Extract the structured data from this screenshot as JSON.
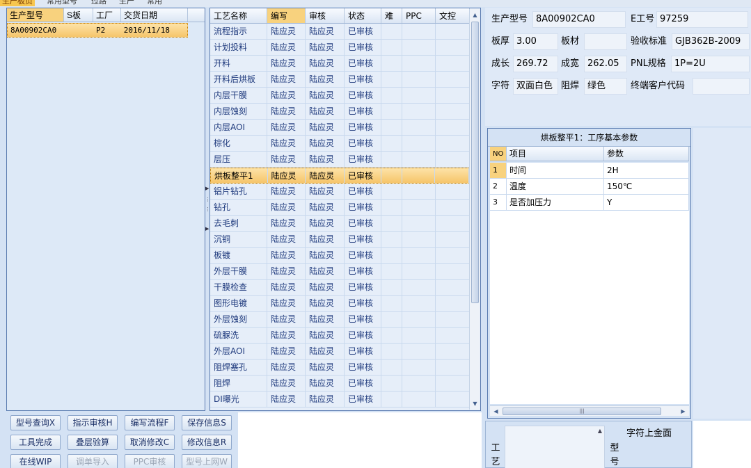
{
  "top_tabs": [
    {
      "label": "生产板页",
      "active": true
    },
    {
      "label": "常用型号"
    },
    {
      "label": "过路"
    },
    {
      "label": "生产"
    },
    {
      "label": "常用"
    }
  ],
  "product_list": {
    "headers": [
      "生产型号",
      "S板",
      "工厂",
      "交货日期"
    ],
    "rows": [
      {
        "model": "8A00902CA0",
        "s": "",
        "factory": "P2",
        "date": "2016/11/18"
      }
    ]
  },
  "process_grid": {
    "headers": [
      "工艺名称",
      "编写",
      "审核",
      "状态",
      "难",
      "PPC",
      "文控"
    ],
    "rows": [
      {
        "name": "流程指示",
        "writer": "陆应灵",
        "reviewer": "陆应灵",
        "status": "已审核"
      },
      {
        "name": "计划投料",
        "writer": "陆应灵",
        "reviewer": "陆应灵",
        "status": "已审核"
      },
      {
        "name": "开料",
        "writer": "陆应灵",
        "reviewer": "陆应灵",
        "status": "已审核"
      },
      {
        "name": "开料后烘板",
        "writer": "陆应灵",
        "reviewer": "陆应灵",
        "status": "已审核"
      },
      {
        "name": "内层干膜",
        "writer": "陆应灵",
        "reviewer": "陆应灵",
        "status": "已审核"
      },
      {
        "name": "内层蚀刻",
        "writer": "陆应灵",
        "reviewer": "陆应灵",
        "status": "已审核"
      },
      {
        "name": "内层AOI",
        "writer": "陆应灵",
        "reviewer": "陆应灵",
        "status": "已审核"
      },
      {
        "name": "棕化",
        "writer": "陆应灵",
        "reviewer": "陆应灵",
        "status": "已审核"
      },
      {
        "name": "层压",
        "writer": "陆应灵",
        "reviewer": "陆应灵",
        "status": "已审核"
      },
      {
        "name": "烘板整平1",
        "writer": "陆应灵",
        "reviewer": "陆应灵",
        "status": "已审核",
        "selected": true
      },
      {
        "name": "铝片钻孔",
        "writer": "陆应灵",
        "reviewer": "陆应灵",
        "status": "已审核"
      },
      {
        "name": "钻孔",
        "writer": "陆应灵",
        "reviewer": "陆应灵",
        "status": "已审核"
      },
      {
        "name": "去毛刺",
        "writer": "陆应灵",
        "reviewer": "陆应灵",
        "status": "已审核"
      },
      {
        "name": "沉铜",
        "writer": "陆应灵",
        "reviewer": "陆应灵",
        "status": "已审核"
      },
      {
        "name": "板镀",
        "writer": "陆应灵",
        "reviewer": "陆应灵",
        "status": "已审核"
      },
      {
        "name": "外层干膜",
        "writer": "陆应灵",
        "reviewer": "陆应灵",
        "status": "已审核"
      },
      {
        "name": "干膜检查",
        "writer": "陆应灵",
        "reviewer": "陆应灵",
        "status": "已审核"
      },
      {
        "name": "图形电镀",
        "writer": "陆应灵",
        "reviewer": "陆应灵",
        "status": "已审核"
      },
      {
        "name": "外层蚀刻",
        "writer": "陆应灵",
        "reviewer": "陆应灵",
        "status": "已审核"
      },
      {
        "name": "硫脲洗",
        "writer": "陆应灵",
        "reviewer": "陆应灵",
        "status": "已审核"
      },
      {
        "name": "外层AOI",
        "writer": "陆应灵",
        "reviewer": "陆应灵",
        "status": "已审核"
      },
      {
        "name": "阻焊塞孔",
        "writer": "陆应灵",
        "reviewer": "陆应灵",
        "status": "已审核"
      },
      {
        "name": "阻焊",
        "writer": "陆应灵",
        "reviewer": "陆应灵",
        "status": "已审核"
      },
      {
        "name": "DI曝光",
        "writer": "陆应灵",
        "reviewer": "陆应灵",
        "status": "已审核"
      }
    ]
  },
  "buttons": [
    {
      "label": "型号查询X",
      "enabled": true
    },
    {
      "label": "指示审核H",
      "enabled": true
    },
    {
      "label": "编写流程F",
      "enabled": true
    },
    {
      "label": "保存信息S",
      "enabled": true
    },
    {
      "label": "工具完成",
      "enabled": true
    },
    {
      "label": "叠层验算",
      "enabled": true
    },
    {
      "label": "取消修改C",
      "enabled": true
    },
    {
      "label": "修改信息R",
      "enabled": true
    },
    {
      "label": "在线WIP",
      "enabled": true
    },
    {
      "label": "调单导入",
      "enabled": false
    },
    {
      "label": "PPC审核",
      "enabled": false
    },
    {
      "label": "型号上网W",
      "enabled": false
    }
  ],
  "info": {
    "model_label": "生产型号",
    "model_value": "8A00902CA0",
    "e_label": "E工号",
    "e_value": "97259",
    "thickness_label": "板厚",
    "thickness_value": "3.00",
    "material_label": "板材",
    "material_value": "",
    "standard_label": "验收标准",
    "standard_value": "GJB362B-2009",
    "length_label": "成长",
    "length_value": "269.72",
    "width_label": "成宽",
    "width_value": "262.05",
    "pnl_label": "PNL规格",
    "pnl_value": "1P=2U",
    "char_label": "字符",
    "char_value": "双面白色",
    "mask_label": "阻焊",
    "mask_value": "绿色",
    "customer_label": "终端客户代码",
    "customer_value": ""
  },
  "params": {
    "title": "烘板整平1：工序基本参数",
    "headers": [
      "NO",
      "项目",
      "参数"
    ],
    "rows": [
      {
        "no": "1",
        "item": "时间",
        "value": "2H"
      },
      {
        "no": "2",
        "item": "温度",
        "value": "150℃"
      },
      {
        "no": "3",
        "item": "是否加压力",
        "value": "Y"
      }
    ]
  },
  "bottom": {
    "craft_label_1": "工",
    "craft_label_2": "艺",
    "model_label_1": "型",
    "model_label_2": "号",
    "note": "字符上金面"
  },
  "colors": {
    "selection": "#f6c56a",
    "panel_bg": "#d4e2f4",
    "text_blue": "#1f3a7d"
  }
}
